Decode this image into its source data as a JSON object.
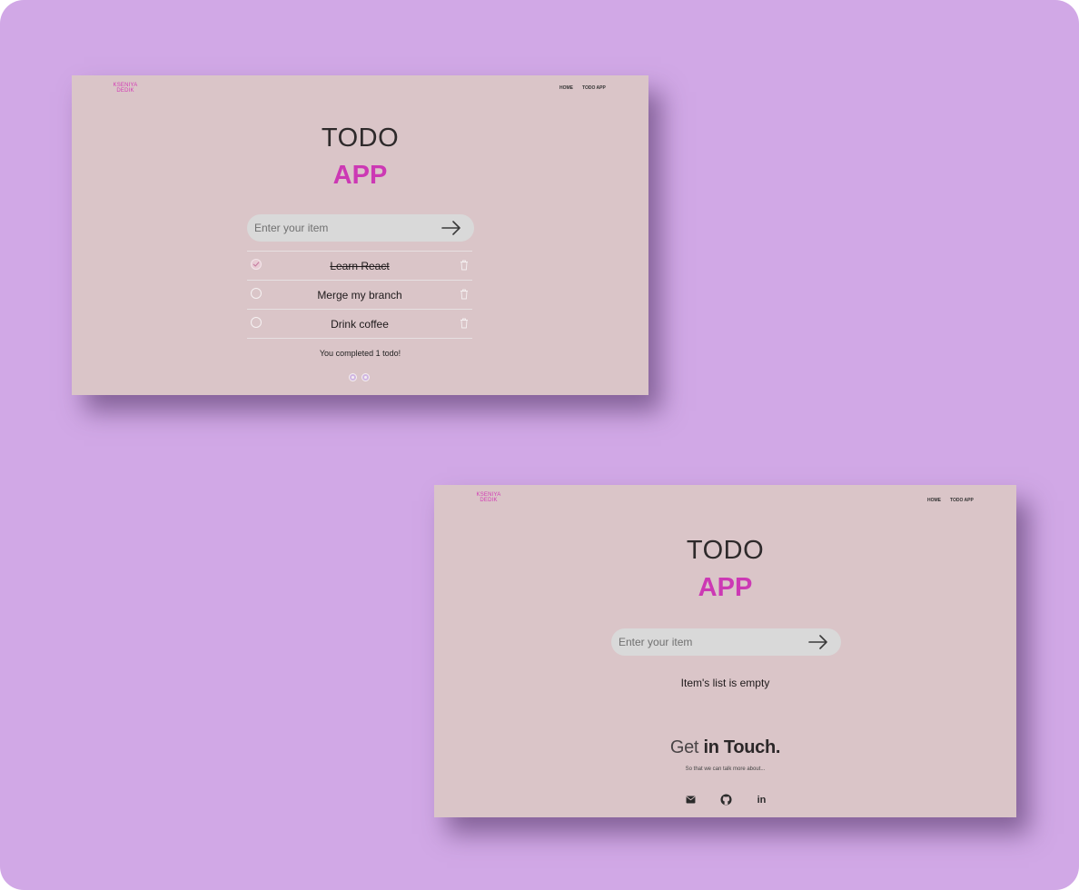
{
  "colors": {
    "background": "#d1a8e6",
    "card": "#dac5c8",
    "accent": "#cc39b4",
    "input": "#d9d9d9"
  },
  "screen1": {
    "logo": {
      "line1": "KSENIYA",
      "line2": "DEDIK"
    },
    "nav": {
      "home": "HOME",
      "todo_app": "TODO APP"
    },
    "title": {
      "line1": "TODO",
      "line2": "APP"
    },
    "input": {
      "placeholder": "Enter your item",
      "value": ""
    },
    "todos": [
      {
        "text": "Learn React",
        "completed": true
      },
      {
        "text": "Merge my branch",
        "completed": false
      },
      {
        "text": "Drink coffee",
        "completed": false
      }
    ],
    "status": "You completed 1 todo!"
  },
  "screen2": {
    "logo": {
      "line1": "KSENIYA",
      "line2": "DEDIK"
    },
    "nav": {
      "home": "HOME",
      "todo_app": "TODO APP"
    },
    "title": {
      "line1": "TODO",
      "line2": "APP"
    },
    "input": {
      "placeholder": "Enter your item",
      "value": ""
    },
    "empty_message": "Item's list is empty",
    "contact": {
      "title_part1": "Get",
      "title_part2": "in Touch.",
      "subtitle": "So that we can talk more about...",
      "icons": [
        "email-icon",
        "github-icon",
        "linkedin-icon"
      ],
      "linkedin_glyph": "in"
    }
  }
}
